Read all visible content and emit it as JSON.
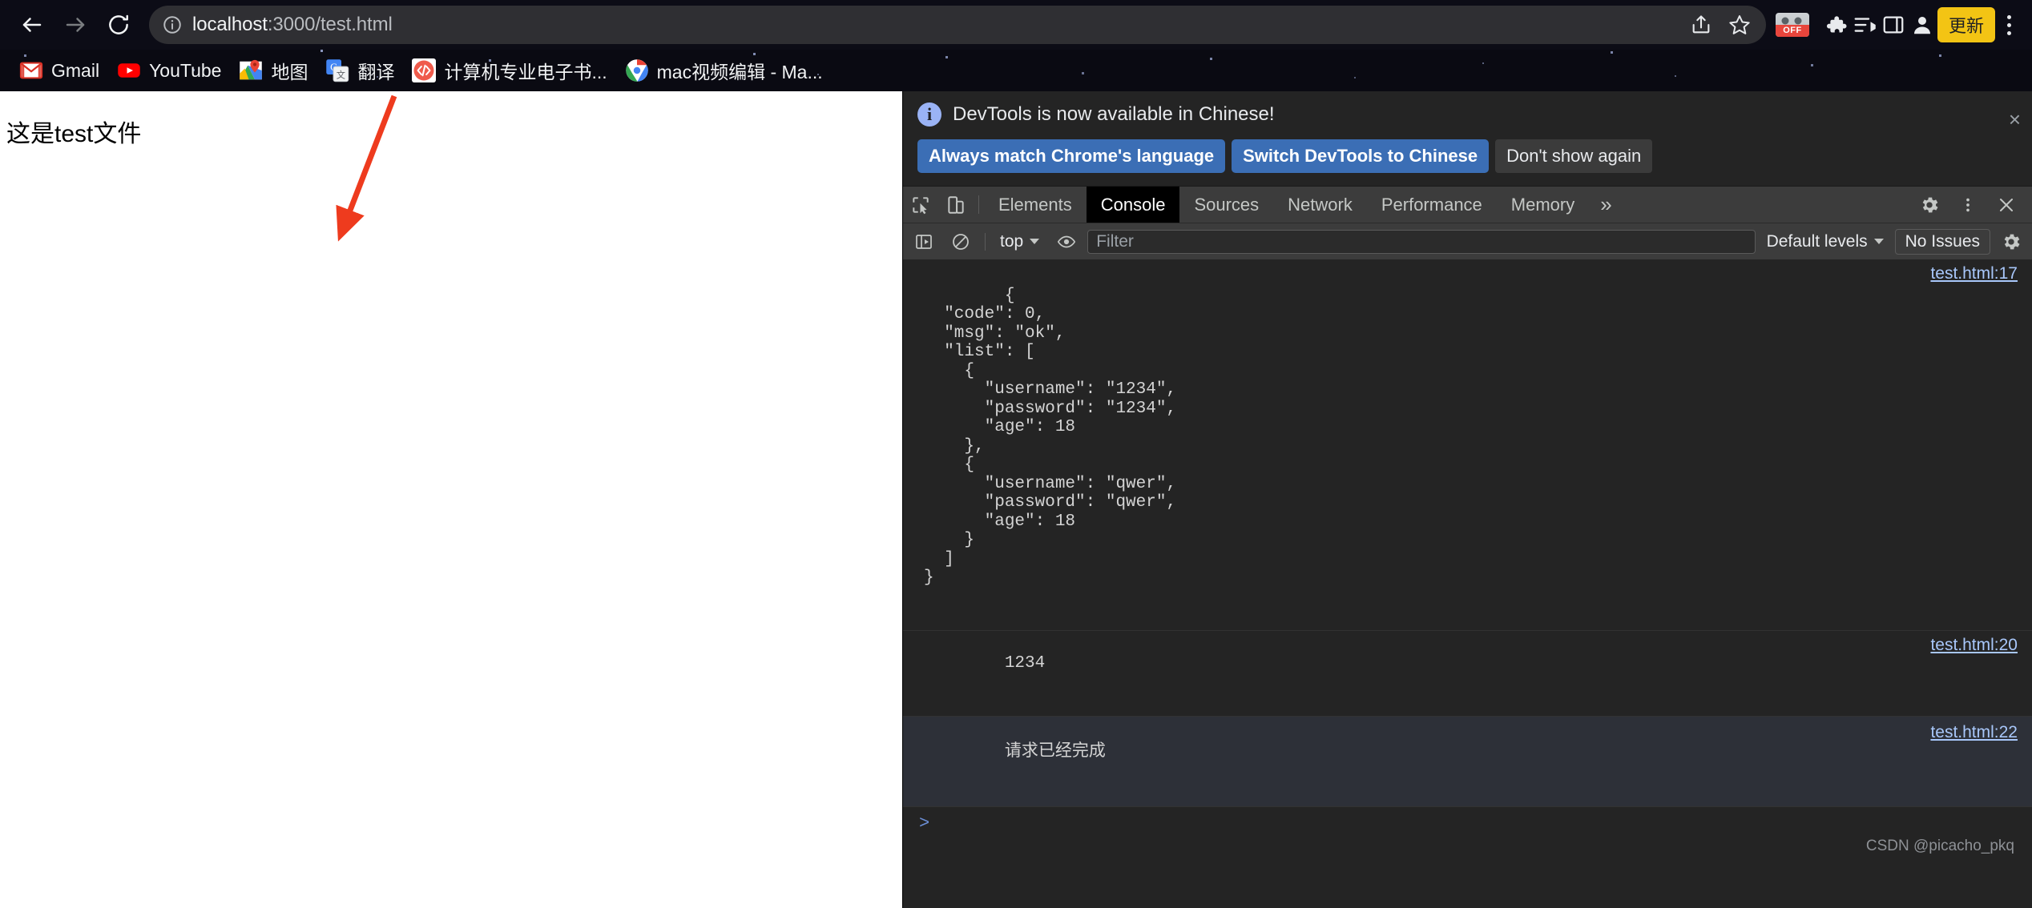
{
  "browser": {
    "nav": {
      "back_label": "Back",
      "forward_label": "Forward",
      "reload_label": "Reload"
    },
    "omnibox": {
      "site_info_label": "View site information",
      "url_host": "localhost",
      "url_path": ":3000/test.html",
      "share_label": "Share this page",
      "bookmark_label": "Bookmark this tab"
    },
    "extension_badge": "OFF",
    "update_button": "更新",
    "menu_label": "Customize and control Google Chrome",
    "bookmarks": [
      {
        "label": "Gmail",
        "icon": "gmail-icon"
      },
      {
        "label": "YouTube",
        "icon": "youtube-icon"
      },
      {
        "label": "地图",
        "icon": "google-maps-icon"
      },
      {
        "label": "翻译",
        "icon": "google-translate-icon"
      },
      {
        "label": "计算机专业电子书...",
        "icon": "code-icon"
      },
      {
        "label": "mac视频编辑 - Ma...",
        "icon": "chrome-icon"
      }
    ]
  },
  "page": {
    "body_text": "这是test文件"
  },
  "annotation": {
    "color": "#ee3b1e",
    "type": "arrow"
  },
  "devtools": {
    "banner": {
      "message": "DevTools is now available in Chinese!",
      "buttons": [
        {
          "label": "Always match Chrome's language",
          "style": "primary"
        },
        {
          "label": "Switch DevTools to Chinese",
          "style": "primary"
        },
        {
          "label": "Don't show again",
          "style": "plain"
        }
      ],
      "close_label": "×"
    },
    "tabs": [
      {
        "label": "Elements",
        "active": false
      },
      {
        "label": "Console",
        "active": true
      },
      {
        "label": "Sources",
        "active": false
      },
      {
        "label": "Network",
        "active": false
      },
      {
        "label": "Performance",
        "active": false
      },
      {
        "label": "Memory",
        "active": false
      }
    ],
    "more_tabs_label": "»",
    "console_toolbar": {
      "context": "top",
      "filter_placeholder": "Filter",
      "filter_value": "",
      "levels": "Default levels",
      "issues": "No Issues"
    },
    "console_messages": [
      {
        "kind": "object",
        "source": "test.html:17",
        "text": "{\n  \"code\": 0,\n  \"msg\": \"ok\",\n  \"list\": [\n    {\n      \"username\": \"1234\",\n      \"password\": \"1234\",\n      \"age\": 18\n    },\n    {\n      \"username\": \"qwer\",\n      \"password\": \"qwer\",\n      \"age\": 18\n    }\n  ]\n}"
      },
      {
        "kind": "text",
        "source": "test.html:20",
        "text": "1234"
      },
      {
        "kind": "text-cn",
        "source": "test.html:22",
        "text": "请求已经完成"
      }
    ],
    "prompt_symbol": ">",
    "watermark": "CSDN @picacho_pkq"
  }
}
